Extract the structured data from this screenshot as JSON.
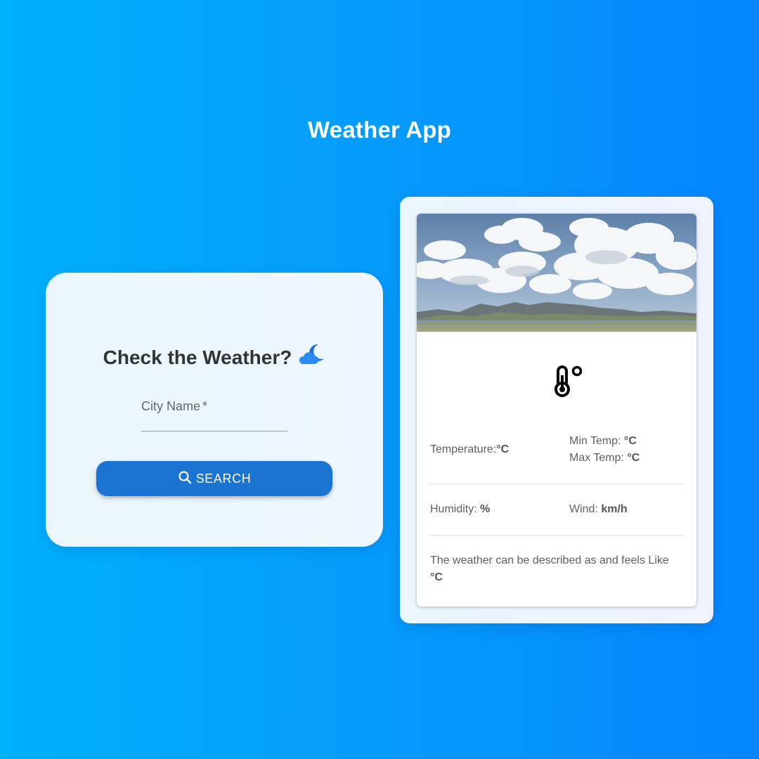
{
  "app": {
    "title": "Weather App"
  },
  "search": {
    "heading": "Check the Weather?",
    "heading_icon": "cloud-moon-icon",
    "city_label": "City Name",
    "required_mark": "*",
    "city_value": "",
    "button_label": "SEARCH",
    "button_icon": "search-icon"
  },
  "info": {
    "image": "sky-clouds-mountains-lake-photo",
    "icon": "thermometer-icon",
    "temperature_label": "Temperature:",
    "temperature_unit": "°C",
    "min_temp_label": "Min Temp: ",
    "min_temp_unit": "°C",
    "max_temp_label": "Max Temp: ",
    "max_temp_unit": "°C",
    "humidity_label": "Humidity: ",
    "humidity_unit": "%",
    "wind_label": "Wind: ",
    "wind_unit": "km/h",
    "description_text": "The weather can be described as and feels Like ",
    "feels_like_unit": "°C"
  },
  "colors": {
    "background_start": "#00b0fb",
    "background_end": "#0585fd",
    "button": "#1c74d2",
    "card": "#eef7ff"
  }
}
